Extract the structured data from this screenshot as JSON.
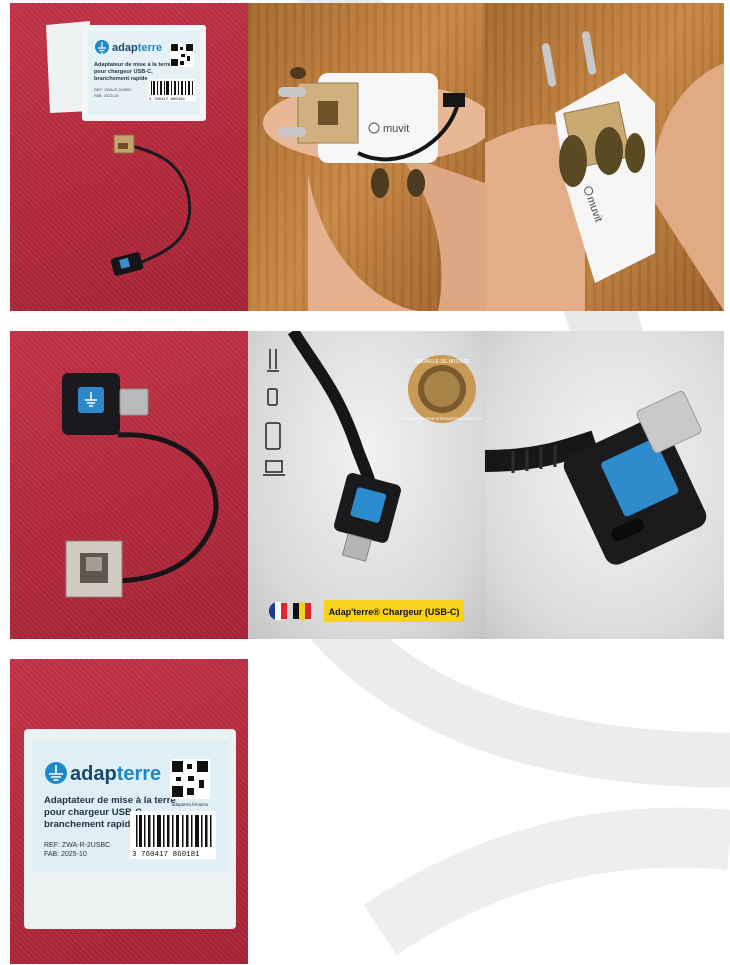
{
  "tiles": {
    "box_top": {
      "brand_a": "adap",
      "brand_b": "terre",
      "line1": "Adaptateur de mise à la terre",
      "line2": "pour chargeur USB-C,",
      "line3": "branchement rapide",
      "ref": "REF: ZWA-R-2USBC",
      "fab": "FAB: 2025-10",
      "barcode_a": "3",
      "barcode_b": "760417",
      "barcode_c": "860181"
    },
    "hand_front": {
      "logo": "muvit"
    },
    "hand_back": {
      "logo": "muvit"
    },
    "promo": {
      "medal_top": "MÉDAILLE DE BRONZE",
      "medal_bottom": "CONCOURS LÉPINE INTERNATIONAL PARIS 2025",
      "banner": "Adap'terre® Chargeur (USB-C)"
    },
    "box_front": {
      "brand_a": "adap",
      "brand_b": "terre",
      "line1": "Adaptateur de mise à la terre",
      "line2": "pour chargeur USB-C,",
      "line3": "branchement rapide",
      "url": "adapterre.fr/notice",
      "ref": "REF: ZWA-R-2USBC",
      "fab": "FAB: 2025-10",
      "barcode_a": "3",
      "barcode_b": "760417",
      "barcode_c": "860181"
    }
  },
  "colors": {
    "brand_blue": "#1e88c9",
    "banner_yellow": "#f7d21c",
    "fabric_red": "#b82c40"
  }
}
